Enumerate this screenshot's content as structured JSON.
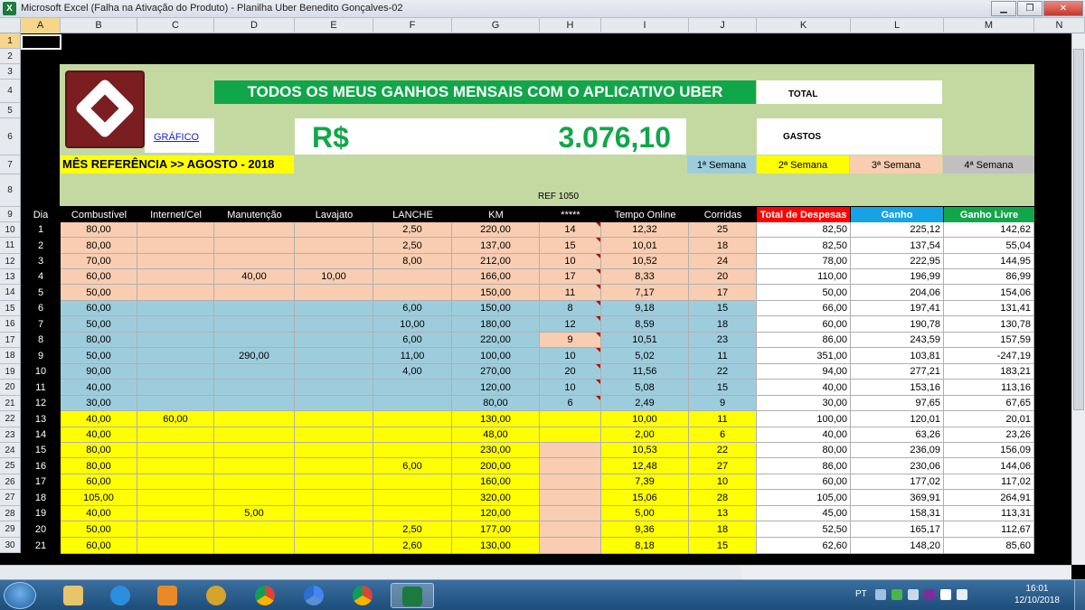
{
  "window": {
    "title": "Microsoft Excel (Falha na Ativação do Produto) - Planilha Uber Benedito Gonçalves-02",
    "app_icon_letter": "X",
    "minimize": "▁",
    "restore": "❐",
    "close": "✕"
  },
  "columns": [
    "A",
    "B",
    "C",
    "D",
    "E",
    "F",
    "G",
    "H",
    "I",
    "J",
    "K",
    "L",
    "M",
    "N"
  ],
  "selected_column": "A",
  "rows_visible": [
    "1",
    "2",
    "3",
    "4",
    "5",
    "6",
    "7",
    "8",
    "9",
    "10",
    "11",
    "12",
    "13",
    "14",
    "15",
    "16",
    "17",
    "18",
    "19",
    "20",
    "21",
    "22",
    "23",
    "24",
    "25",
    "26",
    "27",
    "28",
    "29",
    "30"
  ],
  "header": {
    "headline": "TODOS OS MEUS GANHOS MENSAIS COM O APLICATIVO UBER",
    "total_label": "TOTAL",
    "grafico_link": "GRÁFICO",
    "currency_symbol": "R$",
    "total_value": "3.076,10",
    "gastos_label": "GASTOS",
    "mes_referencia": "MÊS REFERÊNCIA >>  AGOSTO - 2018",
    "semanas": [
      "1ª Semana",
      "2ª Semana",
      "3ª Semana",
      "4ª Semana"
    ],
    "ref": "REF  1050"
  },
  "colors": {
    "week1": "#9dcddc",
    "week2": "#ffff00",
    "week3": "#f9cdb1",
    "week4": "#c0c0c0",
    "banner": "#c4d9a1",
    "green": "#12a64a",
    "red": "#ff0000",
    "blue": "#15a3e6"
  },
  "table": {
    "headers": [
      "Dia",
      "Combustível",
      "Internet/Cel",
      "Manutenção",
      "Lavajato",
      "LANCHE",
      "KM",
      "*****",
      "Tempo Online",
      "Corridas",
      "Total de Despesas",
      "Ganho",
      "Ganho Livre"
    ],
    "rows": [
      {
        "dia": "1",
        "comb": "80,00",
        "net": "",
        "man": "",
        "lav": "",
        "lan": "2,50",
        "km": "220,00",
        "est": "14",
        "tempo": "12,32",
        "corr": "25",
        "desp": "82,50",
        "ganho": "225,12",
        "livre": "142,62",
        "week": 3
      },
      {
        "dia": "2",
        "comb": "80,00",
        "net": "",
        "man": "",
        "lav": "",
        "lan": "2,50",
        "km": "137,00",
        "est": "15",
        "tempo": "10,01",
        "corr": "18",
        "desp": "82,50",
        "ganho": "137,54",
        "livre": "55,04",
        "week": 3
      },
      {
        "dia": "3",
        "comb": "70,00",
        "net": "",
        "man": "",
        "lav": "",
        "lan": "8,00",
        "km": "212,00",
        "est": "10",
        "tempo": "10,52",
        "corr": "24",
        "desp": "78,00",
        "ganho": "222,95",
        "livre": "144,95",
        "week": 3
      },
      {
        "dia": "4",
        "comb": "60,00",
        "net": "",
        "man": "40,00",
        "lav": "10,00",
        "lan": "",
        "km": "166,00",
        "est": "17",
        "tempo": "8,33",
        "corr": "20",
        "desp": "110,00",
        "ganho": "196,99",
        "livre": "86,99",
        "week": 3
      },
      {
        "dia": "5",
        "comb": "50,00",
        "net": "",
        "man": "",
        "lav": "",
        "lan": "",
        "km": "150,00",
        "est": "11",
        "tempo": "7,17",
        "corr": "17",
        "desp": "50,00",
        "ganho": "204,06",
        "livre": "154,06",
        "week": 3
      },
      {
        "dia": "6",
        "comb": "60,00",
        "net": "",
        "man": "",
        "lav": "",
        "lan": "6,00",
        "km": "150,00",
        "est": "8",
        "tempo": "9,18",
        "corr": "15",
        "desp": "66,00",
        "ganho": "197,41",
        "livre": "131,41",
        "week": 1
      },
      {
        "dia": "7",
        "comb": "50,00",
        "net": "",
        "man": "",
        "lav": "",
        "lan": "10,00",
        "km": "180,00",
        "est": "12",
        "tempo": "8,59",
        "corr": "18",
        "desp": "60,00",
        "ganho": "190,78",
        "livre": "130,78",
        "week": 1
      },
      {
        "dia": "8",
        "comb": "80,00",
        "net": "",
        "man": "",
        "lav": "",
        "lan": "6,00",
        "km": "220,00",
        "est": "9",
        "tempo": "10,51",
        "corr": "23",
        "desp": "86,00",
        "ganho": "243,59",
        "livre": "157,59",
        "week": 1
      },
      {
        "dia": "9",
        "comb": "50,00",
        "net": "",
        "man": "290,00",
        "lav": "",
        "lan": "11,00",
        "km": "100,00",
        "est": "10",
        "tempo": "5,02",
        "corr": "11",
        "desp": "351,00",
        "ganho": "103,81",
        "livre": "-247,19",
        "week": 1
      },
      {
        "dia": "10",
        "comb": "90,00",
        "net": "",
        "man": "",
        "lav": "",
        "lan": "4,00",
        "km": "270,00",
        "est": "20",
        "tempo": "11,56",
        "corr": "22",
        "desp": "94,00",
        "ganho": "277,21",
        "livre": "183,21",
        "week": 1
      },
      {
        "dia": "11",
        "comb": "40,00",
        "net": "",
        "man": "",
        "lav": "",
        "lan": "",
        "km": "120,00",
        "est": "10",
        "tempo": "5,08",
        "corr": "15",
        "desp": "40,00",
        "ganho": "153,16",
        "livre": "113,16",
        "week": 1
      },
      {
        "dia": "12",
        "comb": "30,00",
        "net": "",
        "man": "",
        "lav": "",
        "lan": "",
        "km": "80,00",
        "est": "6",
        "tempo": "2,49",
        "corr": "9",
        "desp": "30,00",
        "ganho": "97,65",
        "livre": "67,65",
        "week": 1
      },
      {
        "dia": "13",
        "comb": "40,00",
        "net": "60,00",
        "man": "",
        "lav": "",
        "lan": "",
        "km": "130,00",
        "est": "",
        "tempo": "10,00",
        "corr": "11",
        "desp": "100,00",
        "ganho": "120,01",
        "livre": "20,01",
        "week": 2
      },
      {
        "dia": "14",
        "comb": "40,00",
        "net": "",
        "man": "",
        "lav": "",
        "lan": "",
        "km": "48,00",
        "est": "",
        "tempo": "2,00",
        "corr": "6",
        "desp": "40,00",
        "ganho": "63,26",
        "livre": "23,26",
        "week": 2
      },
      {
        "dia": "15",
        "comb": "80,00",
        "net": "",
        "man": "",
        "lav": "",
        "lan": "",
        "km": "230,00",
        "est": "",
        "tempo": "10,53",
        "corr": "22",
        "desp": "80,00",
        "ganho": "236,09",
        "livre": "156,09",
        "week": 2
      },
      {
        "dia": "16",
        "comb": "80,00",
        "net": "",
        "man": "",
        "lav": "",
        "lan": "6,00",
        "km": "200,00",
        "est": "",
        "tempo": "12,48",
        "corr": "27",
        "desp": "86,00",
        "ganho": "230,06",
        "livre": "144,06",
        "week": 2
      },
      {
        "dia": "17",
        "comb": "60,00",
        "net": "",
        "man": "",
        "lav": "",
        "lan": "",
        "km": "160,00",
        "est": "",
        "tempo": "7,39",
        "corr": "10",
        "desp": "60,00",
        "ganho": "177,02",
        "livre": "117,02",
        "week": 2
      },
      {
        "dia": "18",
        "comb": "105,00",
        "net": "",
        "man": "",
        "lav": "",
        "lan": "",
        "km": "320,00",
        "est": "",
        "tempo": "15,06",
        "corr": "28",
        "desp": "105,00",
        "ganho": "369,91",
        "livre": "264,91",
        "week": 2
      },
      {
        "dia": "19",
        "comb": "40,00",
        "net": "",
        "man": "5,00",
        "lav": "",
        "lan": "",
        "km": "120,00",
        "est": "",
        "tempo": "5,00",
        "corr": "13",
        "desp": "45,00",
        "ganho": "158,31",
        "livre": "113,31",
        "week": 2
      },
      {
        "dia": "20",
        "comb": "50,00",
        "net": "",
        "man": "",
        "lav": "",
        "lan": "2,50",
        "km": "177,00",
        "est": "",
        "tempo": "9,36",
        "corr": "18",
        "desp": "52,50",
        "ganho": "165,17",
        "livre": "112,67",
        "week": 2
      },
      {
        "dia": "21",
        "comb": "60,00",
        "net": "",
        "man": "",
        "lav": "",
        "lan": "2,60",
        "km": "130,00",
        "est": "",
        "tempo": "8,18",
        "corr": "15",
        "desp": "62,60",
        "ganho": "148,20",
        "livre": "85,60",
        "week": 2
      }
    ]
  },
  "taskbar": {
    "language": "PT",
    "time": "16:01",
    "date": "12/10/2018"
  }
}
